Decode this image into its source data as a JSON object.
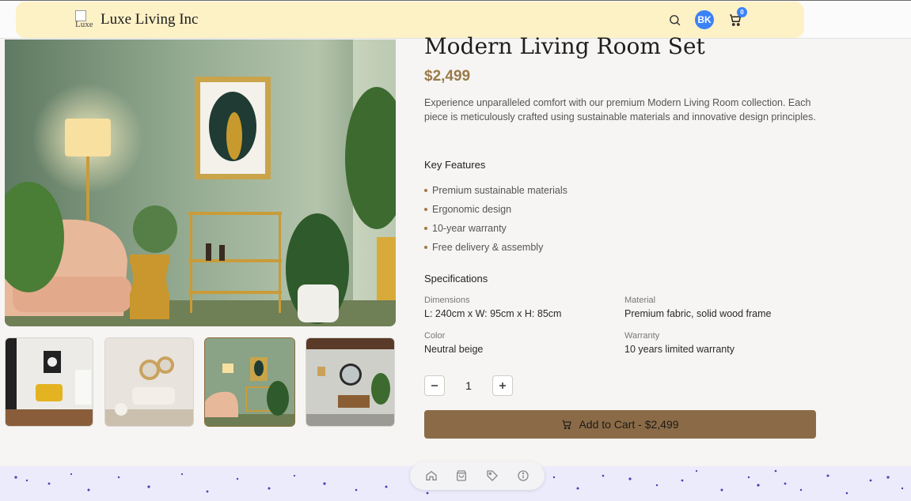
{
  "header": {
    "brand": "Luxe Living Inc",
    "logo_alt": "Luxe",
    "avatar_initials": "BK",
    "cart_count": "0"
  },
  "product": {
    "title": "Modern Living Room Set",
    "price": "$2,499",
    "description": "Experience unparalleled comfort with our premium Modern Living Room collection. Each piece is meticulously crafted using sustainable materials and innovative design principles.",
    "features_heading": "Key Features",
    "features": [
      "Premium sustainable materials",
      "Ergonomic design",
      "10-year warranty",
      "Free delivery & assembly"
    ],
    "specs_heading": "Specifications",
    "specs": [
      {
        "label": "Dimensions",
        "value": "L: 240cm x W: 95cm x H: 85cm"
      },
      {
        "label": "Material",
        "value": "Premium fabric, solid wood frame"
      },
      {
        "label": "Color",
        "value": "Neutral beige"
      },
      {
        "label": "Warranty",
        "value": "10 years limited warranty"
      }
    ],
    "quantity": "1",
    "add_to_cart_label": "Add to Cart - $2,499"
  },
  "gallery": {
    "thumbnails": [
      "living room with yellow chair",
      "beige living room with round mirrors",
      "green living room with bar cart",
      "living room with round mirror and console"
    ],
    "active_index": 2
  },
  "dock": {
    "icons": [
      "home-icon",
      "bag-icon",
      "tag-icon",
      "info-icon"
    ]
  },
  "colors": {
    "accent": "#8b6b47",
    "price": "#9a7a4a",
    "nav_bg": "#fdf1c6",
    "avatar": "#3b82f6"
  }
}
